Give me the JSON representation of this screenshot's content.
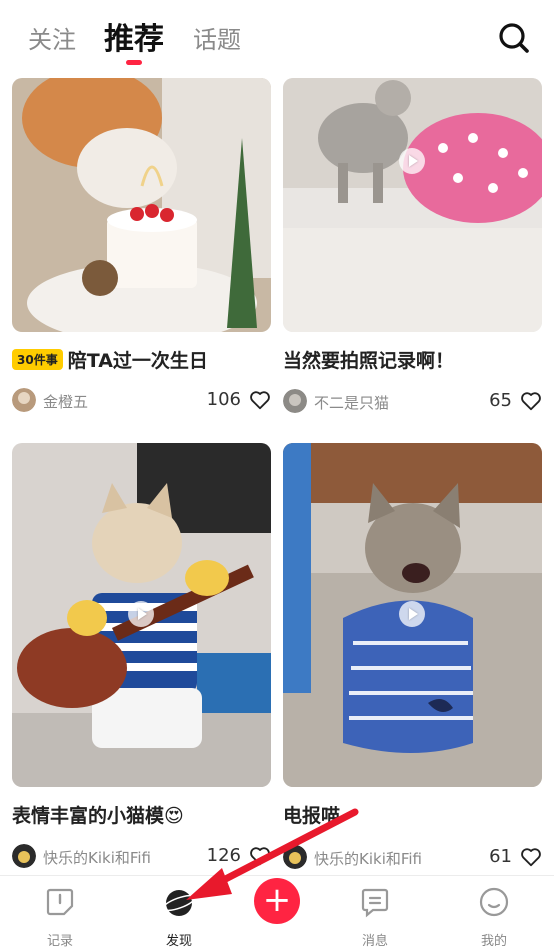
{
  "tabs": [
    {
      "label": "关注",
      "active": false
    },
    {
      "label": "推荐",
      "active": true
    },
    {
      "label": "话题",
      "active": false
    }
  ],
  "feed": [
    {
      "title": "陪TA过一次生日",
      "badge": "30件事",
      "author": "金橙五",
      "likes": "106",
      "video": false
    },
    {
      "title": "当然要拍照记录啊！",
      "badge": "",
      "author": "不二是只猫",
      "likes": "65",
      "video": true
    },
    {
      "title": "表情丰富的小猫模😍",
      "badge": "",
      "author": "快乐的Kiki和Fifi",
      "likes": "126",
      "video": true
    },
    {
      "title": "电报喵",
      "badge": "",
      "author": "快乐的Kiki和Fifi",
      "likes": "61",
      "video": true
    }
  ],
  "bottom_nav": {
    "items": [
      {
        "label": "记录",
        "icon": "record-icon",
        "active": false
      },
      {
        "label": "发现",
        "icon": "discover-icon",
        "active": true
      },
      {
        "label": "消息",
        "icon": "message-icon",
        "active": false
      },
      {
        "label": "我的",
        "icon": "profile-icon",
        "active": false
      }
    ],
    "plus_label": "+"
  },
  "colors": {
    "accent": "#ff2442",
    "badge": "#ffcc00",
    "annotation_arrow": "#e8192c"
  }
}
